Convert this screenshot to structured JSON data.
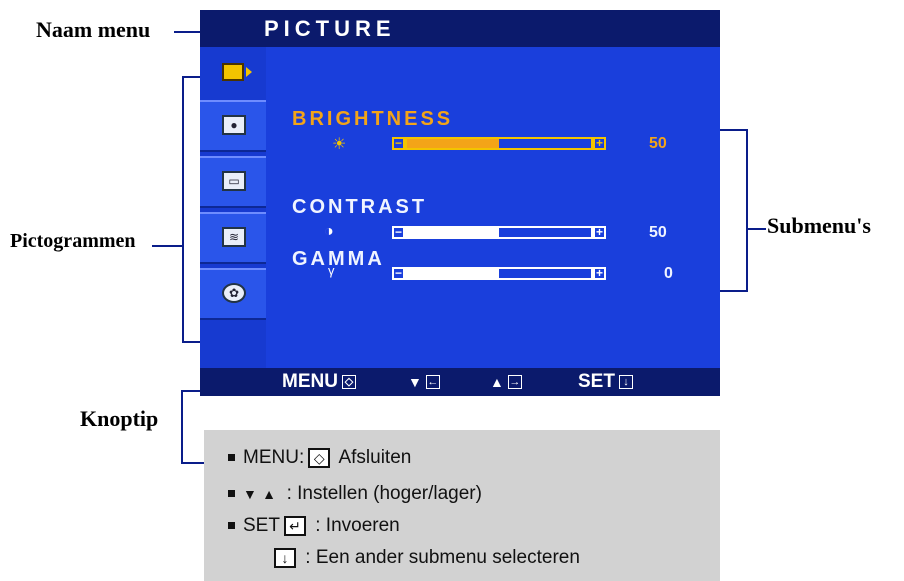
{
  "callouts": {
    "menu_name": "Naam menu",
    "icons": "Pictogrammen",
    "submenus": "Submenu's",
    "button_tip": "Knoptip"
  },
  "osd": {
    "title": "PICTURE",
    "tabs": [
      "picture-icon",
      "color-icon",
      "position-icon",
      "tracking-icon",
      "setup-icon"
    ],
    "submenus": [
      {
        "label": "BRIGHTNESS",
        "icon": "☀",
        "value": "50",
        "level": 0.5,
        "selected": true
      },
      {
        "label": "CONTRAST",
        "icon": "◑",
        "value": "50",
        "level": 0.5,
        "selected": false
      },
      {
        "label": "GAMMA",
        "icon": "γ",
        "value": "0",
        "level": 0.5,
        "selected": false
      }
    ],
    "bottom": {
      "menu": "MENU",
      "down": "▼",
      "up": "▲",
      "set": "SET"
    }
  },
  "legend": {
    "row1_prefix": "MENU:",
    "row1_text": "Afsluiten",
    "row2_text": ": Instellen (hoger/lager)",
    "row3_prefix": "SET",
    "row3_text": ": Invoeren",
    "row4_text": ": Een ander submenu selecteren"
  },
  "colors": {
    "osd_blue": "#1a3fdc",
    "osd_dark": "#0b1a6c",
    "selected": "#f3a418",
    "leader_lines": "#0a1d8a"
  }
}
